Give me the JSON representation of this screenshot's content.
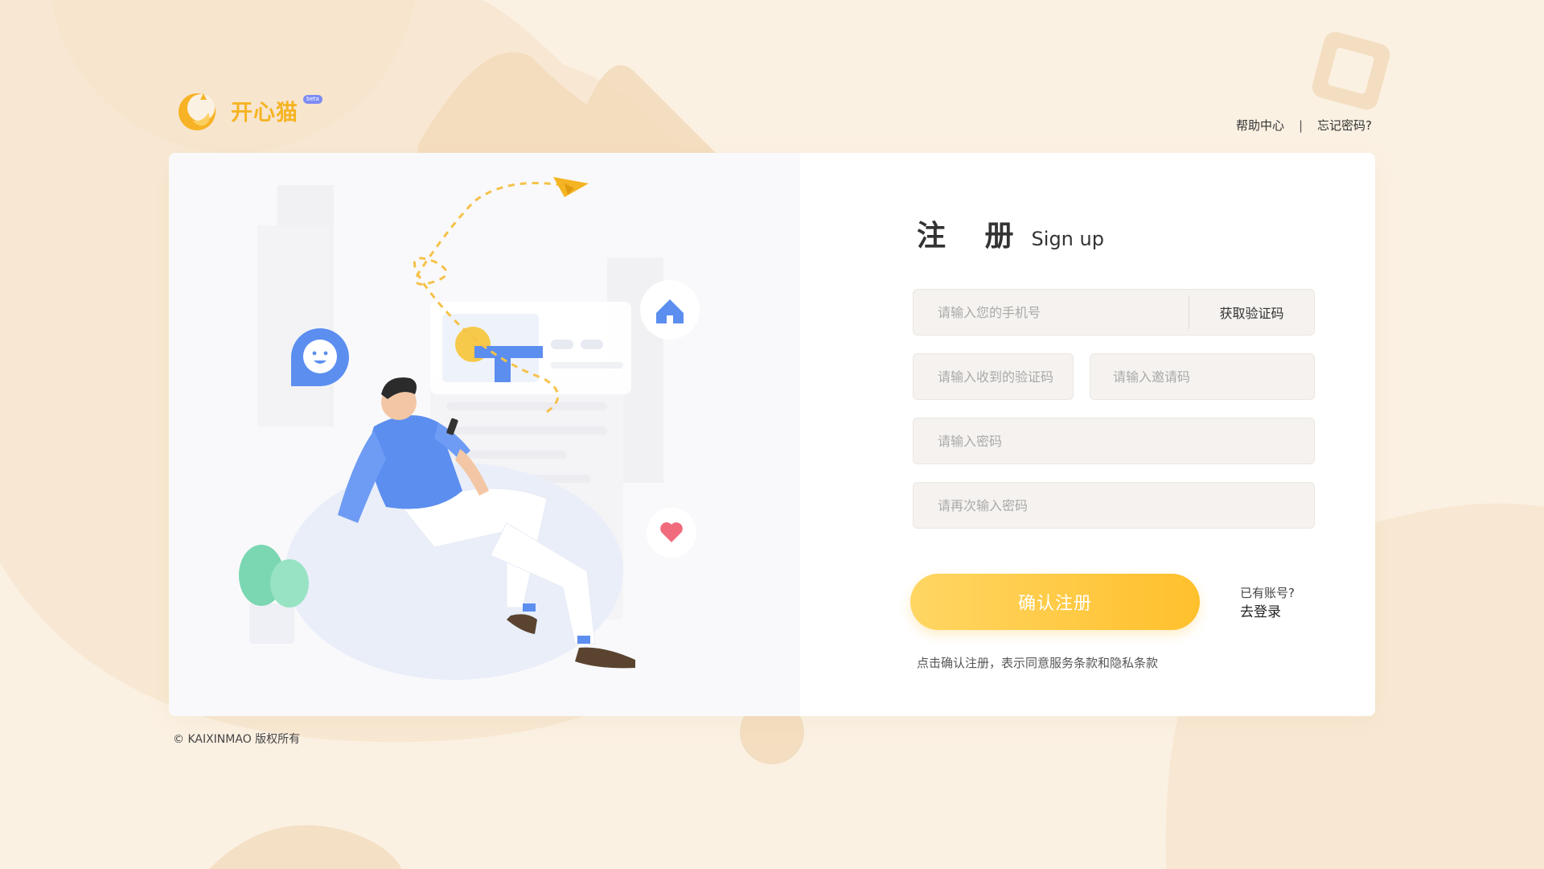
{
  "brand": {
    "name": "开心猫",
    "badge": "beta",
    "primary_color": "#f5b423"
  },
  "header": {
    "help_link": "帮助中心",
    "separator": "|",
    "forgot_link": "忘记密码?"
  },
  "form": {
    "title_cn": "注 册",
    "title_en": "Sign up",
    "phone_placeholder": "请输入您的手机号",
    "get_code_label": "获取验证码",
    "code_placeholder": "请输入收到的验证码",
    "invite_placeholder": "请输入邀请码",
    "password_placeholder": "请输入密码",
    "password_confirm_placeholder": "请再次输入密码",
    "submit_label": "确认注册",
    "submit_color": "#ffc02c",
    "has_account": "已有账号?",
    "login_link": "去登录",
    "terms": "点击确认注册，表示同意服务条款和隐私条款"
  },
  "footer": {
    "copyright": "© KAIXINMAO 版权所有"
  },
  "icons": {
    "logo": "cat-moon-logo-icon",
    "home": "home-icon",
    "smile": "smile-icon",
    "heart": "heart-icon",
    "plane": "paper-plane-icon"
  }
}
